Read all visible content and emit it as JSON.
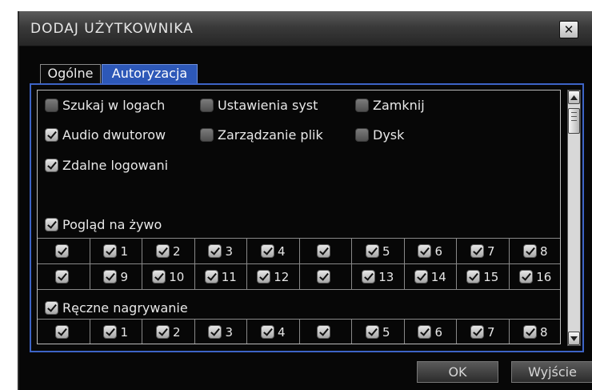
{
  "dialog": {
    "title": "DODAJ UŻYTKOWNIKA",
    "close_label": "✕"
  },
  "tabs": [
    {
      "label": "Ogólne",
      "active": false
    },
    {
      "label": "Autoryzacja",
      "active": true
    }
  ],
  "permissions": {
    "row1": [
      {
        "label": "Szukaj w logach",
        "checked": false
      },
      {
        "label": "Ustawienia syst",
        "checked": false
      },
      {
        "label": "Zamknij",
        "checked": false
      }
    ],
    "row2": [
      {
        "label": "Audio dwutorow",
        "checked": true
      },
      {
        "label": "Zarządzanie plik",
        "checked": false
      },
      {
        "label": "Dysk",
        "checked": false
      }
    ],
    "row3": [
      {
        "label": "Zdalne logowani",
        "checked": true
      }
    ],
    "live_view": {
      "label": "Pogląd na żywo",
      "checked": true
    },
    "manual_rec": {
      "label": "Ręczne nagrywanie",
      "checked": true
    }
  },
  "live_grid": [
    [
      "",
      "1",
      "2",
      "3",
      "4",
      "",
      "5",
      "6",
      "7",
      "8"
    ],
    [
      "",
      "9",
      "10",
      "11",
      "12",
      "",
      "13",
      "14",
      "15",
      "16"
    ]
  ],
  "rec_grid": [
    [
      "",
      "1",
      "2",
      "3",
      "4",
      "",
      "5",
      "6",
      "7",
      "8"
    ]
  ],
  "buttons": {
    "ok": "OK",
    "exit": "Wyjście"
  }
}
